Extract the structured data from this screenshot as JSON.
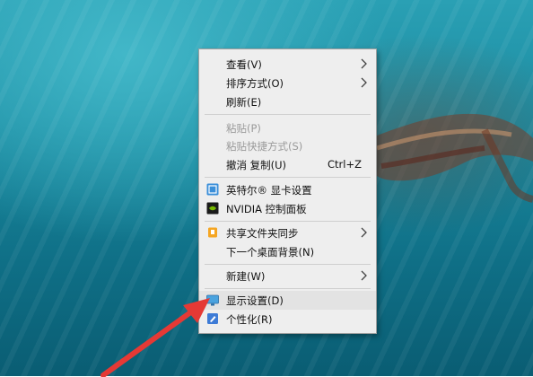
{
  "context_menu": {
    "items": [
      {
        "label": "查看(V)"
      },
      {
        "label": "排序方式(O)"
      },
      {
        "label": "刷新(E)"
      },
      {
        "label": "粘贴(P)"
      },
      {
        "label": "粘贴快捷方式(S)"
      },
      {
        "label": "撤消 复制(U)",
        "shortcut": "Ctrl+Z"
      },
      {
        "label": "英特尔® 显卡设置",
        "icon": "intel-graphics-icon"
      },
      {
        "label": "NVIDIA 控制面板",
        "icon": "nvidia-icon"
      },
      {
        "label": "共享文件夹同步",
        "icon": "share-sync-icon"
      },
      {
        "label": "下一个桌面背景(N)"
      },
      {
        "label": "新建(W)"
      },
      {
        "label": "显示设置(D)",
        "icon": "display-icon"
      },
      {
        "label": "个性化(R)",
        "icon": "personalize-icon"
      }
    ],
    "highlighted": "显示设置(D)"
  },
  "colors": {
    "menu_bg": "#eeeeee",
    "arrow_red": "#e53935",
    "disabled_text": "#9a9a9a"
  }
}
